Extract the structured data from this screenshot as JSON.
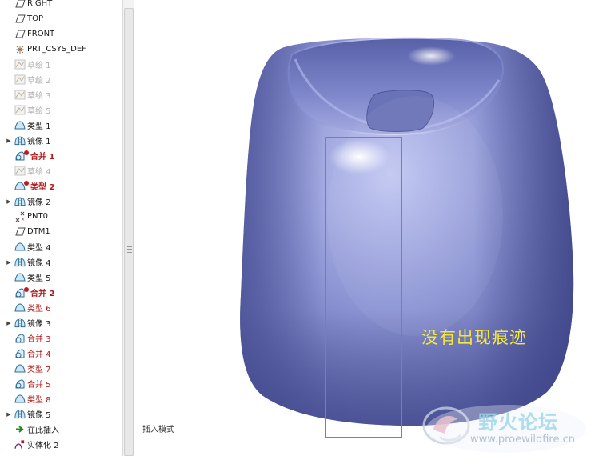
{
  "model_tree": {
    "items": [
      {
        "label": "RIGHT",
        "icon": "datum-plane-icon",
        "style": "normal",
        "expandable": false,
        "error": false
      },
      {
        "label": "TOP",
        "icon": "datum-plane-icon",
        "style": "normal",
        "expandable": false,
        "error": false
      },
      {
        "label": "FRONT",
        "icon": "datum-plane-icon",
        "style": "normal",
        "expandable": false,
        "error": false
      },
      {
        "label": "PRT_CSYS_DEF",
        "icon": "csys-icon",
        "style": "normal",
        "expandable": false,
        "error": false
      },
      {
        "label": "草绘 1",
        "icon": "sketch-icon",
        "style": "suppressed",
        "expandable": false,
        "error": false
      },
      {
        "label": "草绘 2",
        "icon": "sketch-icon",
        "style": "suppressed",
        "expandable": false,
        "error": false
      },
      {
        "label": "草绘 3",
        "icon": "sketch-icon",
        "style": "suppressed",
        "expandable": false,
        "error": false
      },
      {
        "label": "草绘 5",
        "icon": "sketch-icon",
        "style": "suppressed",
        "expandable": false,
        "error": false
      },
      {
        "label": "类型 1",
        "icon": "surface-icon",
        "style": "normal",
        "expandable": false,
        "error": false
      },
      {
        "label": "镜像 1",
        "icon": "mirror-icon",
        "style": "normal",
        "expandable": true,
        "error": false
      },
      {
        "label": "合并 1",
        "icon": "merge-icon",
        "style": "redbold",
        "expandable": false,
        "error": true
      },
      {
        "label": "草绘 4",
        "icon": "sketch-icon",
        "style": "suppressed",
        "expandable": false,
        "error": false
      },
      {
        "label": "类型 2",
        "icon": "surface-icon",
        "style": "redbold",
        "expandable": false,
        "error": true
      },
      {
        "label": "镜像 2",
        "icon": "mirror-icon",
        "style": "normal",
        "expandable": true,
        "error": false
      },
      {
        "label": "PNT0",
        "icon": "datum-point-icon",
        "style": "normal",
        "expandable": false,
        "error": false
      },
      {
        "label": "DTM1",
        "icon": "datum-plane-icon",
        "style": "normal",
        "expandable": false,
        "error": false
      },
      {
        "label": "类型 4",
        "icon": "surface-icon",
        "style": "normal",
        "expandable": false,
        "error": false
      },
      {
        "label": "镜像 4",
        "icon": "mirror-icon",
        "style": "normal",
        "expandable": true,
        "error": false
      },
      {
        "label": "类型 5",
        "icon": "surface-icon",
        "style": "normal",
        "expandable": false,
        "error": false
      },
      {
        "label": "合并 2",
        "icon": "merge-icon",
        "style": "redbold",
        "expandable": false,
        "error": true
      },
      {
        "label": "类型 6",
        "icon": "surface-icon",
        "style": "red",
        "expandable": false,
        "error": false
      },
      {
        "label": "镜像 3",
        "icon": "mirror-icon",
        "style": "normal",
        "expandable": true,
        "error": false
      },
      {
        "label": "合并 3",
        "icon": "merge-icon",
        "style": "red",
        "expandable": false,
        "error": false
      },
      {
        "label": "合并 4",
        "icon": "merge-icon",
        "style": "red",
        "expandable": false,
        "error": false
      },
      {
        "label": "类型 7",
        "icon": "surface-icon",
        "style": "red",
        "expandable": false,
        "error": false
      },
      {
        "label": "合并 5",
        "icon": "merge-icon",
        "style": "red",
        "expandable": false,
        "error": false
      },
      {
        "label": "类型 8",
        "icon": "surface-icon",
        "style": "red",
        "expandable": false,
        "error": false
      },
      {
        "label": "镜像 5",
        "icon": "mirror-icon",
        "style": "normal",
        "expandable": true,
        "error": false
      },
      {
        "label": "在此插入",
        "icon": "insert-here-icon",
        "style": "normal",
        "expandable": false,
        "error": false
      },
      {
        "label": "实体化 2",
        "icon": "solidify-icon",
        "style": "normal",
        "expandable": false,
        "error": false
      }
    ]
  },
  "viewport": {
    "mode_label": "插入模式",
    "annotation": "没有出现痕迹",
    "highlight_color": "#e040e0",
    "model_color": "#8c94d4"
  },
  "watermark": {
    "title": "野火论坛",
    "url": "www.proewildfire.cn"
  },
  "colors": {
    "error_red": "#b01818",
    "suppressed_gray": "#b0b0b0",
    "annotation_yellow": "#f4e838"
  }
}
